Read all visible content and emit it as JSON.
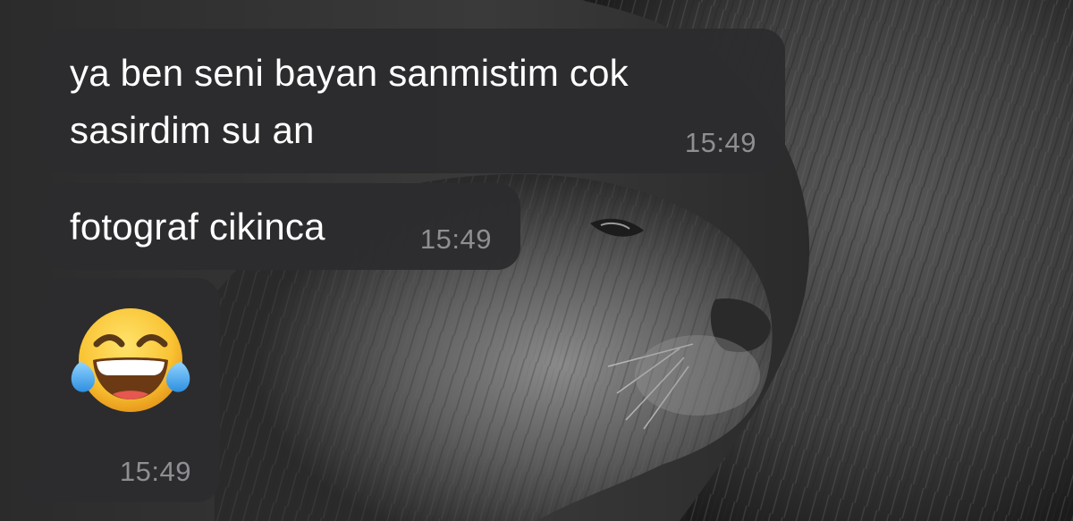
{
  "chat": {
    "messages": [
      {
        "text": "ya ben seni bayan sanmistim cok\nsasirdim su an",
        "time": "15:49"
      },
      {
        "text": "fotograf cikinca",
        "time": "15:49"
      },
      {
        "emoji": "face-with-tears-of-joy-icon",
        "time": "15:49"
      }
    ]
  },
  "theme": {
    "bubble_color": "#2c2c2e",
    "text_color": "#ffffff",
    "time_color": "#8e8e93"
  },
  "wallpaper": {
    "subject": "lion-wallpaper"
  }
}
